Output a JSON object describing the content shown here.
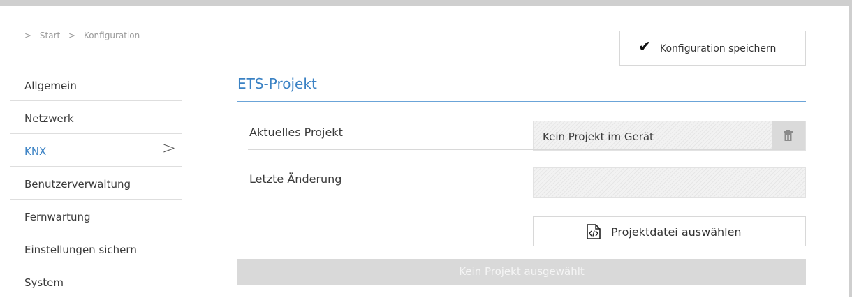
{
  "breadcrumb": {
    "sep": ">",
    "items": [
      "Start",
      "Konfiguration"
    ]
  },
  "sidebar": {
    "items": [
      {
        "label": "Allgemein"
      },
      {
        "label": "Netzwerk"
      },
      {
        "label": "KNX"
      },
      {
        "label": "Benutzerverwaltung"
      },
      {
        "label": "Fernwartung"
      },
      {
        "label": "Einstellungen sichern"
      },
      {
        "label": "System"
      }
    ],
    "active_chevron": ">"
  },
  "toolbar": {
    "save_label": "Konfiguration speichern",
    "check": "✔"
  },
  "section": {
    "title": "ETS-Projekt"
  },
  "form": {
    "current_project_label": "Aktuelles Projekt",
    "current_project_value": "Kein Projekt im Gerät",
    "last_change_label": "Letzte Änderung",
    "last_change_value": "",
    "select_file_label": "Projektdatei auswählen",
    "status_bar_text": "Kein Projekt ausgewählt"
  },
  "colors": {
    "accent": "#3b82c4",
    "disabled_bar": "#d9d9d9"
  }
}
